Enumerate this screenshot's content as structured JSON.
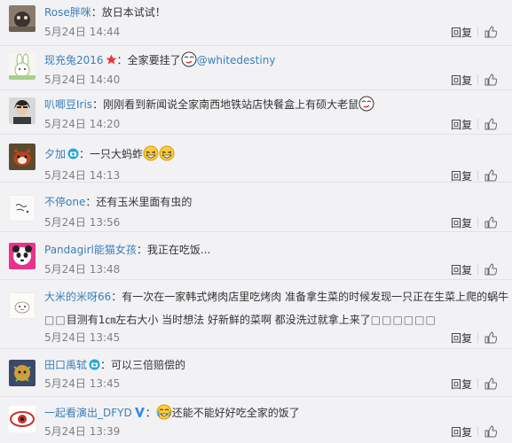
{
  "ui": {
    "reply_label": "回复",
    "like_icon": "thumbs-up-icon",
    "accent": "#3a7fb9",
    "meta_color": "#808080"
  },
  "comments": [
    {
      "user": "Rose胖咪",
      "colon": "：",
      "text": "放日本试试！",
      "time": "5月24日 14:44"
    },
    {
      "user": "现充兔2016",
      "colon": "：",
      "text": "全家要挂了",
      "mention": "@whitedestiny",
      "time": "5月24日 14:40",
      "badge": "red-star-badge-icon",
      "emoji": "smirk-emoji"
    },
    {
      "user": "叭唧豆Iris",
      "colon": "：",
      "text": "刚刚看到新闻说全家南西地铁站店快餐盒上有硕大老鼠",
      "time": "5月24日 14:20",
      "emoji": "smirk-emoji"
    },
    {
      "user": "夕加",
      "colon": "：",
      "text": "一只大蚂蚱",
      "time": "5月24日 14:13",
      "badge": "camera-badge-icon",
      "emoji": "laughing-emoji"
    },
    {
      "user": "不停one",
      "colon": "：",
      "text": "还有玉米里面有虫的",
      "time": "5月24日 13:56"
    },
    {
      "user": "Pandagirl能猫女孩",
      "colon": "：",
      "text": "我正在吃饭...",
      "time": "5月24日 13:48"
    },
    {
      "user": "大米的米呀66",
      "colon": "：",
      "text": "有一次在一家韩式烤肉店里吃烤肉 准备拿生菜的时候发现一只正在生菜上爬的蜗牛",
      "text2": "目测有1㎝左右大小 当时想法 好新鲜的菜啊 都没洗过就拿上来了",
      "boxes1": "□□",
      "boxes2": "□□□□□□",
      "time": "5月24日 13:45"
    },
    {
      "user": "田口禹轼",
      "colon": "：",
      "text": "可以三倍赔偿的",
      "time": "5月24日 13:45",
      "badge": "camera-badge-icon"
    },
    {
      "user": "一起看演出_DFYD",
      "colon": "：",
      "text": "还能不能好好吃全家的饭了",
      "time": "5月24日 13:39",
      "badge": "blue-v-badge-icon",
      "emoji": "crying-laugh-emoji"
    }
  ]
}
